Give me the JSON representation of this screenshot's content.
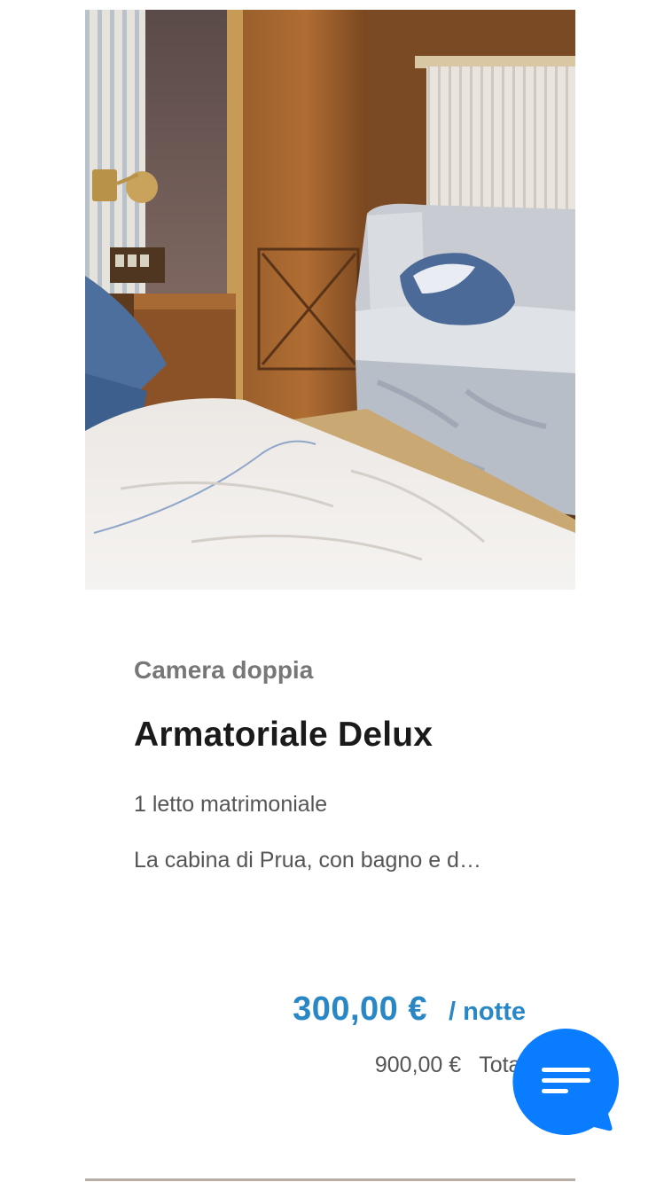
{
  "room": {
    "photo_alt": "Armatoriale Delux",
    "type": "Camera doppia",
    "name": "Armatoriale Delux",
    "beds": "1 letto matrimoniale",
    "description": "La cabina di Prua, con bagno e d…"
  },
  "pricing": {
    "price": "300,00 €",
    "unit": "/ notte",
    "total_amount": "900,00 €",
    "total_label": "Total"
  },
  "chat": {
    "icon": "menu-lines-icon",
    "color": "#0a7cff"
  },
  "colors": {
    "price": "#2a87c6",
    "heading": "#1a1a1a",
    "muted": "#777777",
    "body_text": "#555555"
  }
}
